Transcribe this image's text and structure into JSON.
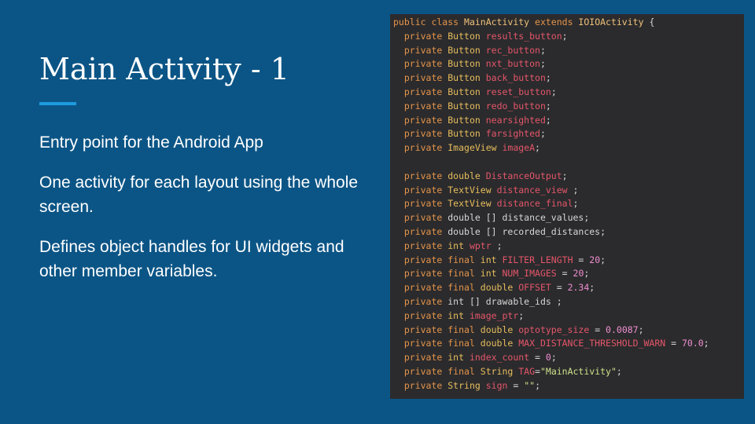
{
  "slide": {
    "title": "Main Activity - 1",
    "bullets": [
      "Entry point for the Android App",
      "One activity for each layout using the whole screen.",
      "Defines object handles for UI widgets and other member variables."
    ]
  },
  "code": {
    "lines": [
      [
        {
          "t": "public class ",
          "c": "kw"
        },
        {
          "t": "MainActivity",
          "c": "cls"
        },
        {
          "t": " extends ",
          "c": "kw"
        },
        {
          "t": "IOIOActivity",
          "c": "cls"
        },
        {
          "t": " {",
          "c": "plain"
        }
      ],
      [
        {
          "t": "  private ",
          "c": "kw"
        },
        {
          "t": "Button ",
          "c": "ty"
        },
        {
          "t": "results_button",
          "c": "id"
        },
        {
          "t": ";",
          "c": "plain"
        }
      ],
      [
        {
          "t": "  private ",
          "c": "kw"
        },
        {
          "t": "Button ",
          "c": "ty"
        },
        {
          "t": "rec_button",
          "c": "id"
        },
        {
          "t": ";",
          "c": "plain"
        }
      ],
      [
        {
          "t": "  private ",
          "c": "kw"
        },
        {
          "t": "Button ",
          "c": "ty"
        },
        {
          "t": "nxt_button",
          "c": "id"
        },
        {
          "t": ";",
          "c": "plain"
        }
      ],
      [
        {
          "t": "  private ",
          "c": "kw"
        },
        {
          "t": "Button ",
          "c": "ty"
        },
        {
          "t": "back_button",
          "c": "id"
        },
        {
          "t": ";",
          "c": "plain"
        }
      ],
      [
        {
          "t": "  private ",
          "c": "kw"
        },
        {
          "t": "Button ",
          "c": "ty"
        },
        {
          "t": "reset_button",
          "c": "id"
        },
        {
          "t": ";",
          "c": "plain"
        }
      ],
      [
        {
          "t": "  private ",
          "c": "kw"
        },
        {
          "t": "Button ",
          "c": "ty"
        },
        {
          "t": "redo_button",
          "c": "id"
        },
        {
          "t": ";",
          "c": "plain"
        }
      ],
      [
        {
          "t": "  private ",
          "c": "kw"
        },
        {
          "t": "Button ",
          "c": "ty"
        },
        {
          "t": "nearsighted",
          "c": "id"
        },
        {
          "t": ";",
          "c": "plain"
        }
      ],
      [
        {
          "t": "  private ",
          "c": "kw"
        },
        {
          "t": "Button ",
          "c": "ty"
        },
        {
          "t": "farsighted",
          "c": "id"
        },
        {
          "t": ";",
          "c": "plain"
        }
      ],
      [
        {
          "t": "  private ",
          "c": "kw"
        },
        {
          "t": "ImageView ",
          "c": "ty"
        },
        {
          "t": "imageA",
          "c": "id"
        },
        {
          "t": ";",
          "c": "plain"
        }
      ],
      [
        {
          "t": "",
          "c": "plain"
        }
      ],
      [
        {
          "t": "  private ",
          "c": "kw"
        },
        {
          "t": "double ",
          "c": "ty"
        },
        {
          "t": "DistanceOutput",
          "c": "id"
        },
        {
          "t": ";",
          "c": "plain"
        }
      ],
      [
        {
          "t": "  private ",
          "c": "kw"
        },
        {
          "t": "TextView ",
          "c": "ty"
        },
        {
          "t": "distance_view",
          "c": "id"
        },
        {
          "t": " ;",
          "c": "plain"
        }
      ],
      [
        {
          "t": "  private ",
          "c": "kw"
        },
        {
          "t": "TextView ",
          "c": "ty"
        },
        {
          "t": "distance_final",
          "c": "id"
        },
        {
          "t": ";",
          "c": "plain"
        }
      ],
      [
        {
          "t": "  private ",
          "c": "kw"
        },
        {
          "t": "double [] distance_values;",
          "c": "plain"
        }
      ],
      [
        {
          "t": "  private ",
          "c": "kw"
        },
        {
          "t": "double [] recorded_distances;",
          "c": "plain"
        }
      ],
      [
        {
          "t": "  private ",
          "c": "kw"
        },
        {
          "t": "int ",
          "c": "ty"
        },
        {
          "t": "wptr",
          "c": "id"
        },
        {
          "t": " ;",
          "c": "plain"
        }
      ],
      [
        {
          "t": "  private final ",
          "c": "kw"
        },
        {
          "t": "int ",
          "c": "ty"
        },
        {
          "t": "FILTER_LENGTH",
          "c": "id"
        },
        {
          "t": " = ",
          "c": "plain"
        },
        {
          "t": "20",
          "c": "num"
        },
        {
          "t": ";",
          "c": "plain"
        }
      ],
      [
        {
          "t": "  private final ",
          "c": "kw"
        },
        {
          "t": "int ",
          "c": "ty"
        },
        {
          "t": "NUM_IMAGES",
          "c": "id"
        },
        {
          "t": " = ",
          "c": "plain"
        },
        {
          "t": "20",
          "c": "num"
        },
        {
          "t": ";",
          "c": "plain"
        }
      ],
      [
        {
          "t": "  private final ",
          "c": "kw"
        },
        {
          "t": "double ",
          "c": "ty"
        },
        {
          "t": "OFFSET",
          "c": "id"
        },
        {
          "t": " = ",
          "c": "plain"
        },
        {
          "t": "2.34",
          "c": "num"
        },
        {
          "t": ";",
          "c": "plain"
        }
      ],
      [
        {
          "t": "  private ",
          "c": "kw"
        },
        {
          "t": "int [] drawable_ids ;",
          "c": "plain"
        }
      ],
      [
        {
          "t": "  private ",
          "c": "kw"
        },
        {
          "t": "int ",
          "c": "ty"
        },
        {
          "t": "image_ptr",
          "c": "id"
        },
        {
          "t": ";",
          "c": "plain"
        }
      ],
      [
        {
          "t": "  private final ",
          "c": "kw"
        },
        {
          "t": "double ",
          "c": "ty"
        },
        {
          "t": "optotype_size",
          "c": "id"
        },
        {
          "t": " = ",
          "c": "plain"
        },
        {
          "t": "0.0087",
          "c": "num"
        },
        {
          "t": ";",
          "c": "plain"
        }
      ],
      [
        {
          "t": "  private final ",
          "c": "kw"
        },
        {
          "t": "double ",
          "c": "ty"
        },
        {
          "t": "MAX_DISTANCE_THRESHOLD_WARN",
          "c": "id"
        },
        {
          "t": " = ",
          "c": "plain"
        },
        {
          "t": "70.0",
          "c": "num"
        },
        {
          "t": ";",
          "c": "plain"
        }
      ],
      [
        {
          "t": "  private ",
          "c": "kw"
        },
        {
          "t": "int ",
          "c": "ty"
        },
        {
          "t": "index_count",
          "c": "id"
        },
        {
          "t": " = ",
          "c": "plain"
        },
        {
          "t": "0",
          "c": "num"
        },
        {
          "t": ";",
          "c": "plain"
        }
      ],
      [
        {
          "t": "  private final ",
          "c": "kw"
        },
        {
          "t": "String ",
          "c": "ty"
        },
        {
          "t": "TAG",
          "c": "id"
        },
        {
          "t": "=",
          "c": "plain"
        },
        {
          "t": "\"MainActivity\"",
          "c": "str"
        },
        {
          "t": ";",
          "c": "plain"
        }
      ],
      [
        {
          "t": "  private ",
          "c": "kw"
        },
        {
          "t": "String ",
          "c": "ty"
        },
        {
          "t": "sign",
          "c": "id"
        },
        {
          "t": " = ",
          "c": "plain"
        },
        {
          "t": "\"\"",
          "c": "str"
        },
        {
          "t": ";",
          "c": "plain"
        }
      ]
    ]
  },
  "colors": {
    "background": "#0b5586",
    "accent": "#1e9bdf",
    "code_background": "#2b2b2d"
  }
}
